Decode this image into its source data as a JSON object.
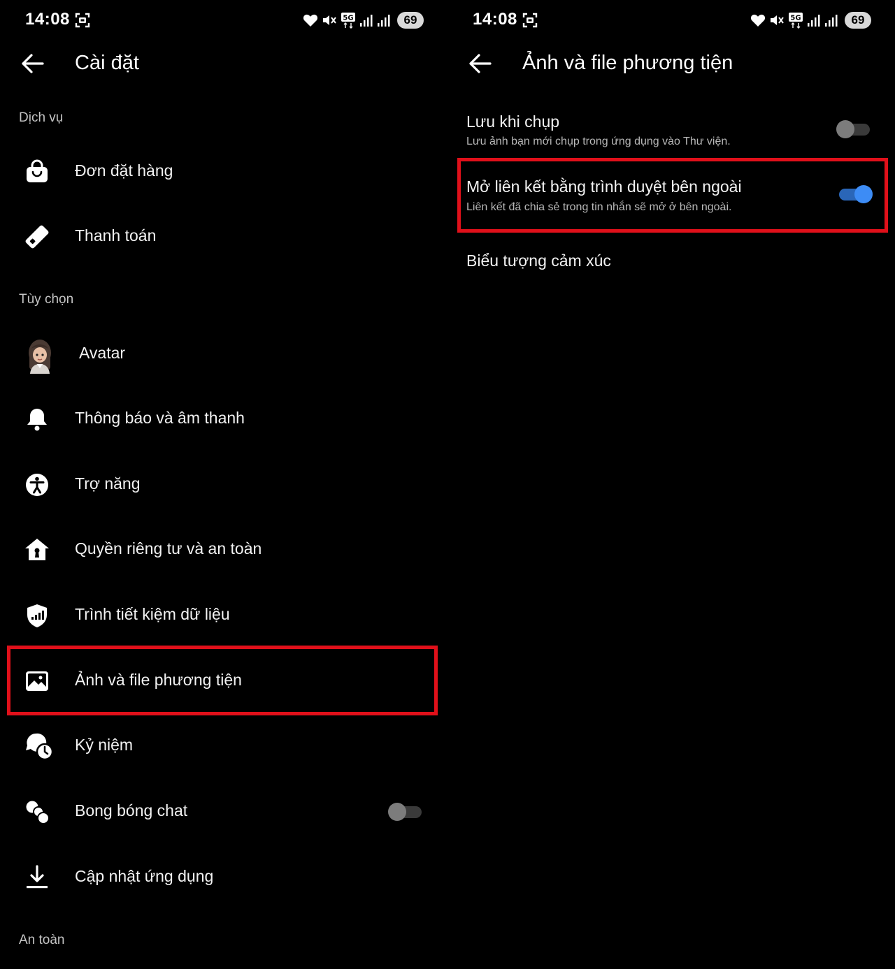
{
  "left_screen": {
    "status": {
      "time": "14:08",
      "battery": "69"
    },
    "header": {
      "title": "Cài đặt"
    },
    "sections": {
      "services": "Dịch vụ",
      "options": "Tùy chọn",
      "safety": "An toàn"
    },
    "items": {
      "orders": "Đơn đặt hàng",
      "payments": "Thanh toán",
      "avatar": "Avatar",
      "notifications": "Thông báo và âm thanh",
      "accessibility": "Trợ năng",
      "privacy": "Quyền riêng tư và an toàn",
      "data_saver": "Trình tiết kiệm dữ liệu",
      "photos_media": "Ảnh và file phương tiện",
      "memories": "Kỷ niệm",
      "chat_heads": "Bong bóng chat",
      "app_updates": "Cập nhật ứng dụng"
    },
    "chat_heads_enabled": false,
    "highlight_color": "#e0101a"
  },
  "right_screen": {
    "status": {
      "time": "14:08",
      "battery": "69"
    },
    "header": {
      "title": "Ảnh và file phương tiện"
    },
    "settings": {
      "save_on_capture": {
        "title": "Lưu khi chụp",
        "subtitle": "Lưu ảnh bạn mới chụp trong ứng dụng vào Thư viện.",
        "enabled": false
      },
      "open_links_externally": {
        "title": "Mở liên kết bằng trình duyệt bên ngoài",
        "subtitle": "Liên kết đã chia sẻ trong tin nhắn sẽ mở ở bên ngoài.",
        "enabled": true
      },
      "emoji": {
        "title": "Biểu tượng cảm xúc"
      }
    },
    "toggle_on_color": "#3d8cf5",
    "highlight_color": "#e0101a"
  }
}
